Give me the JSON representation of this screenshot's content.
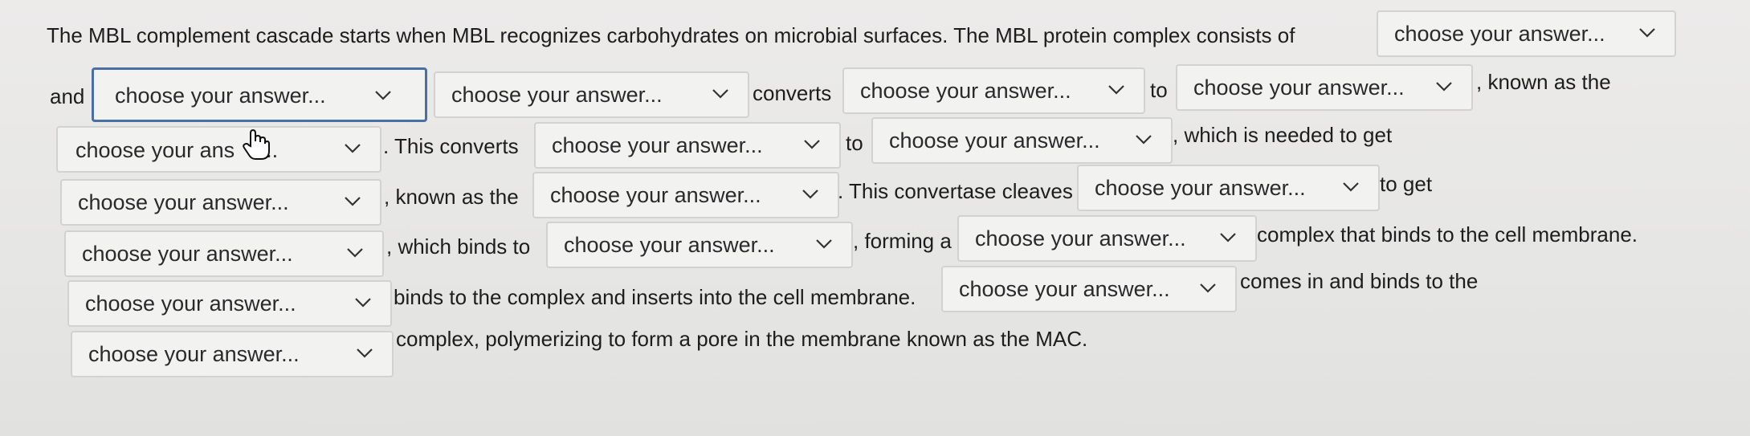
{
  "placeholder": "choose your answer...",
  "placeholder_cut": "choose your ans",
  "placeholder_tail": "r...",
  "text": {
    "t1": "The MBL complement cascade starts when MBL recognizes carbohydrates on microbial surfaces. The MBL protein complex consists of",
    "t2": "and",
    "t3": "converts",
    "t4": "to",
    "t5": ", known as the",
    "t6": ". This converts",
    "t7": "to",
    "t8": ", which is needed to get",
    "t9": ", known as the",
    "t10": ". This convertase cleaves",
    "t11": "to get",
    "t12": ", which binds to",
    "t13": ", forming a",
    "t14": "complex that binds to the cell membrane.",
    "t15": "binds to the complex and inserts into the cell membrane.",
    "t16": "comes in and binds to the",
    "t17": "complex, polymerizing to form a pore in the membrane known as the MAC."
  },
  "icons": {
    "dropdown": "chevron-down-icon",
    "cursor": "hand-pointer-icon"
  }
}
